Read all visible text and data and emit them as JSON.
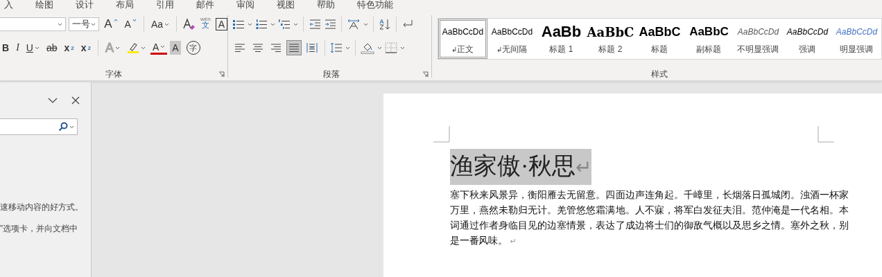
{
  "tabs": [
    {
      "label": "入",
      "selected": false
    },
    {
      "label": "绘图",
      "selected": false
    },
    {
      "label": "设计",
      "selected": false
    },
    {
      "label": "布局",
      "selected": false
    },
    {
      "label": "引用",
      "selected": false
    },
    {
      "label": "邮件",
      "selected": false
    },
    {
      "label": "审阅",
      "selected": false
    },
    {
      "label": "视图",
      "selected": false
    },
    {
      "label": "帮助",
      "selected": false
    },
    {
      "label": "特色功能",
      "selected": false
    }
  ],
  "font_group": {
    "label": "字体",
    "font_size": "一号",
    "row1": [
      {
        "kind": "grow",
        "glyph": "A"
      },
      {
        "kind": "shrink",
        "glyph": "A"
      },
      {
        "kind": "case",
        "glyph": "Aa"
      },
      {
        "kind": "clear"
      },
      {
        "kind": "phonetic",
        "glyph": "文",
        "ruby": "wén"
      },
      {
        "kind": "border",
        "glyph": "A"
      }
    ],
    "row2": [
      {
        "kind": "bold",
        "glyph": "B"
      },
      {
        "kind": "italic",
        "glyph": "I"
      },
      {
        "kind": "underline",
        "glyph": "U"
      },
      {
        "kind": "strike",
        "glyph": "ab"
      },
      {
        "kind": "subscript",
        "glyph": "x",
        "sub": "2"
      },
      {
        "kind": "superscript",
        "glyph": "x",
        "sup": "2"
      },
      {
        "kind": "effects",
        "glyph": "A"
      },
      {
        "kind": "highlight"
      },
      {
        "kind": "color",
        "glyph": "A"
      },
      {
        "kind": "shading",
        "glyph": "A"
      },
      {
        "kind": "enclose",
        "glyph": "字"
      }
    ]
  },
  "paragraph_group": {
    "label": "段落",
    "alignment": [
      {
        "kind": "left",
        "selected": false
      },
      {
        "kind": "center",
        "selected": false
      },
      {
        "kind": "right",
        "selected": false
      },
      {
        "kind": "justify",
        "selected": true
      },
      {
        "kind": "distributed",
        "selected": false
      }
    ]
  },
  "styles_group": {
    "label": "样式",
    "styles": [
      {
        "kind": "normal",
        "preview": "AaBbCcDd",
        "name": "正文",
        "mark": "↲",
        "selected": true
      },
      {
        "kind": "normal",
        "preview": "AaBbCcDd",
        "name": "无间隔",
        "mark": "↲",
        "selected": false
      },
      {
        "kind": "heading1",
        "preview": "AaBb",
        "name": "标题 1",
        "selected": false
      },
      {
        "kind": "heading2",
        "preview": "AaBbC",
        "name": "标题 2",
        "selected": false
      },
      {
        "kind": "title",
        "preview": "AaBbC",
        "name": "标题",
        "selected": false
      },
      {
        "kind": "subtitle",
        "preview": "AaBbC",
        "name": "副标题",
        "selected": false
      },
      {
        "kind": "subtle",
        "preview": "AaBbCcDd",
        "name": "不明显强调",
        "selected": false
      },
      {
        "kind": "emphasis",
        "preview": "AaBbCcDd",
        "name": "强调",
        "selected": false
      },
      {
        "kind": "intense",
        "preview": "AaBbCcDd",
        "name": "明显强调",
        "selected": false
      }
    ]
  },
  "navigation_pane": {
    "texts": [
      "速移动内容的好方式。",
      "”选项卡，并向文档中"
    ]
  },
  "document": {
    "title": "渔家傲·秋思",
    "title_highlighted": true,
    "title_mark": "↵",
    "body": "塞下秋来风景异，衡阳雁去无留意。四面边声连角起。千嶂里，长烟落日孤城闭。浊酒一杯家万里，燕然未勒归无计。羌管悠悠霜满地。人不寐，将军白发征夫泪。范仲淹是一代名相。本词通过作者身临目见的边塞情景，表达了成边将士们的御敌气概以及思乡之情。塞外之秋，别是一番风味。",
    "body_mark": "↵"
  }
}
